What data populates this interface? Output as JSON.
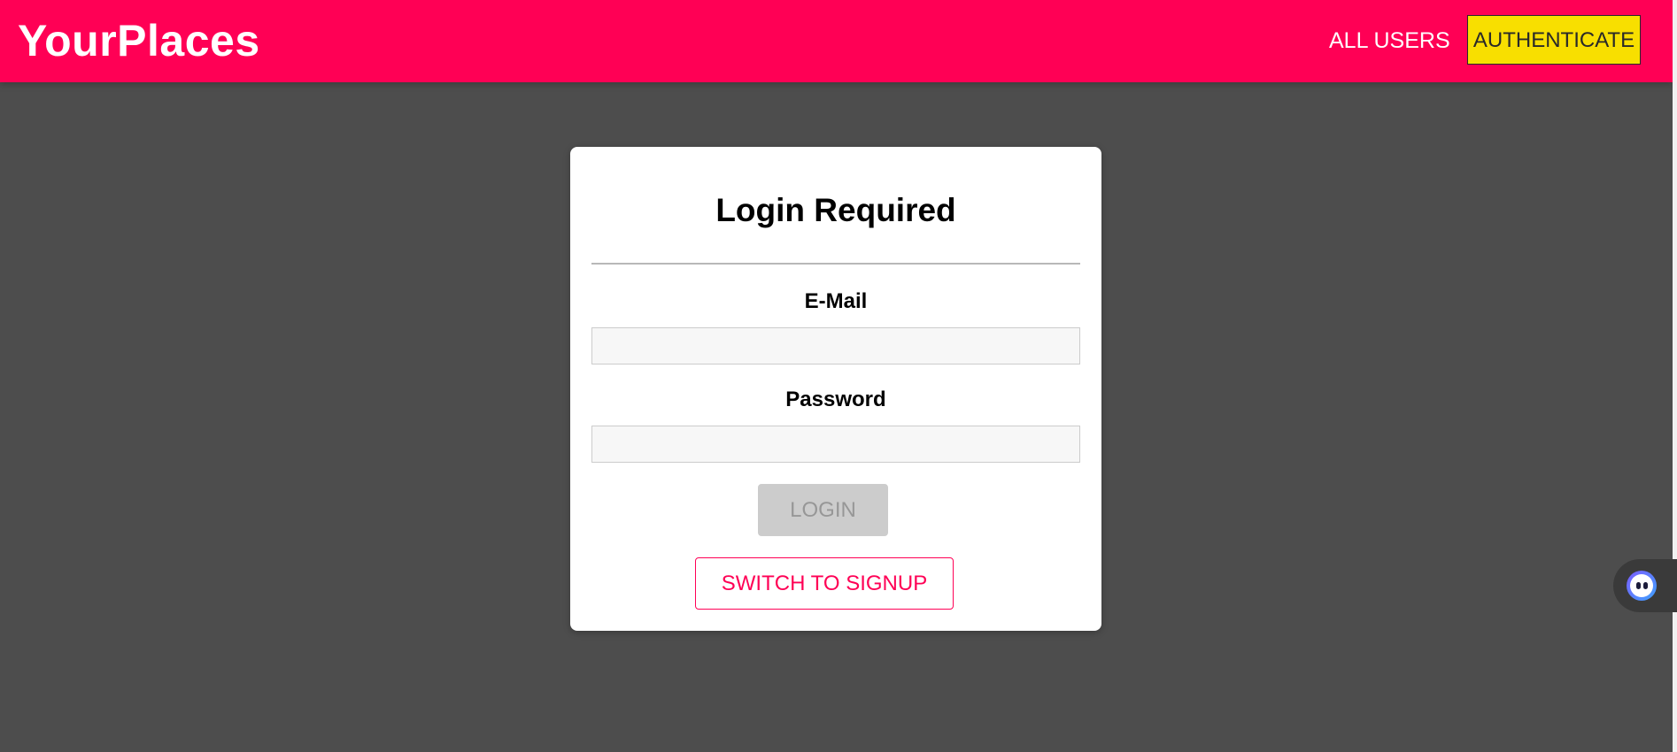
{
  "header": {
    "brand": "YourPlaces",
    "nav": {
      "all_users": "ALL USERS",
      "authenticate": "AUTHENTICATE"
    }
  },
  "auth_card": {
    "title": "Login Required",
    "email": {
      "label": "E-Mail",
      "value": "",
      "placeholder": ""
    },
    "password": {
      "label": "Password",
      "value": "",
      "placeholder": ""
    },
    "login_button": "LOGIN",
    "login_button_state": "disabled",
    "switch_button": "SWITCH TO SIGNUP"
  },
  "assistant_widget": {
    "icon": "assistant-face-icon"
  },
  "colors": {
    "header_bg": "#ff0055",
    "page_bg": "#4d4d4d",
    "auth_button_bg": "#f8df00",
    "accent": "#ff0055",
    "disabled_bg": "#cccccc",
    "disabled_text": "#979797"
  }
}
